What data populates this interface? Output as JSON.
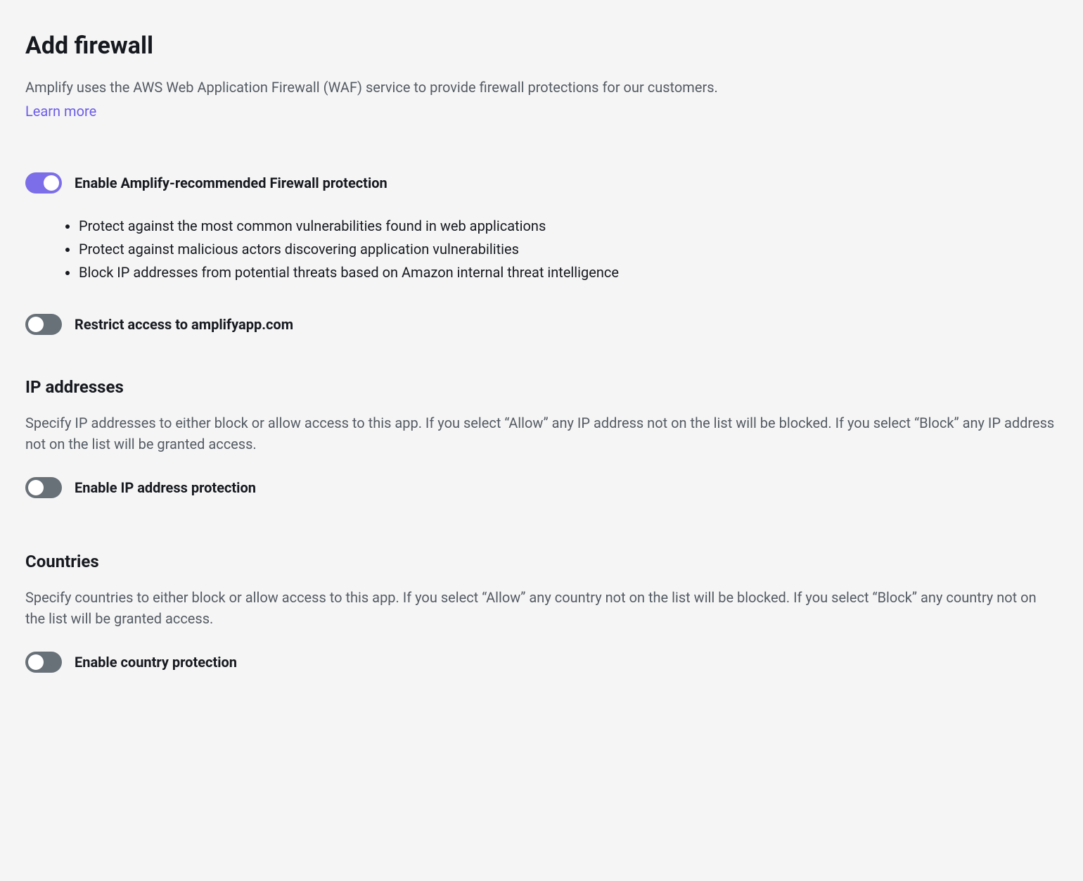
{
  "header": {
    "title": "Add firewall",
    "description": "Amplify uses the AWS Web Application Firewall (WAF) service to provide firewall protections for our customers.",
    "learn_more": "Learn more"
  },
  "recommended": {
    "toggle_label": "Enable Amplify-recommended Firewall protection",
    "enabled": true,
    "bullets": [
      "Protect against the most common vulnerabilities found in web applications",
      "Protect against malicious actors discovering application vulnerabilities",
      "Block IP addresses from potential threats based on Amazon internal threat intelligence"
    ]
  },
  "restrict": {
    "toggle_label": "Restrict access to amplifyapp.com",
    "enabled": false
  },
  "ip": {
    "heading": "IP addresses",
    "description": "Specify IP addresses to either block or allow access to this app. If you select “Allow” any IP address not on the list will be blocked. If you select “Block” any IP address not on the list will be granted access.",
    "toggle_label": "Enable IP address protection",
    "enabled": false
  },
  "countries": {
    "heading": "Countries",
    "description": "Specify countries to either block or allow access to this app. If you select “Allow” any country not on the list will be blocked. If you select “Block” any country not on the list will be granted access.",
    "toggle_label": "Enable country protection",
    "enabled": false
  }
}
